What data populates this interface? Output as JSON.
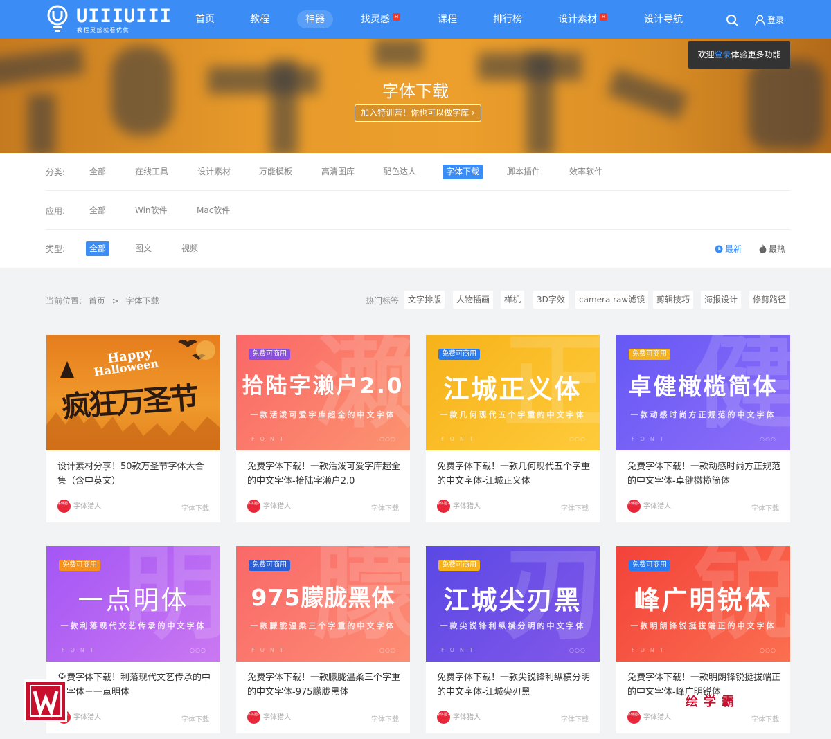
{
  "header": {
    "brand": "UIIIUIII",
    "slogan": "教程灵感就看优优",
    "nav": [
      {
        "label": "首页",
        "hot": false
      },
      {
        "label": "教程",
        "hot": false
      },
      {
        "label": "神器",
        "hot": false
      },
      {
        "label": "找灵感",
        "hot": true
      },
      {
        "label": "课程",
        "hot": false
      },
      {
        "label": "排行榜",
        "hot": false
      },
      {
        "label": "设计素材",
        "hot": true
      },
      {
        "label": "设计导航",
        "hot": false
      }
    ],
    "hot_badge": "H",
    "login": "登录",
    "colors": {
      "primary": "#3b8cf5",
      "hot": "#f0392b"
    }
  },
  "banner": {
    "title": "字体下载",
    "button": "加入特训营！你也可以做字库",
    "tooltip_prefix": "欢迎",
    "tooltip_link": "登录",
    "tooltip_suffix": "体验更多功能"
  },
  "filters": {
    "category": {
      "label": "分类:",
      "options": [
        "全部",
        "在线工具",
        "设计素材",
        "万能模板",
        "高清图库",
        "配色达人",
        "字体下载",
        "脚本插件",
        "效率软件"
      ],
      "active": "字体下载"
    },
    "application": {
      "label": "应用:",
      "options": [
        "全部",
        "Win软件",
        "Mac软件"
      ]
    },
    "type": {
      "label": "类型:",
      "options": [
        "全部",
        "图文",
        "视频"
      ],
      "active": "全部"
    },
    "sort_latest": "最新",
    "sort_hot": "最热"
  },
  "breadcrumb": {
    "prefix": "当前位置:",
    "home": "首页",
    "sep": ">",
    "current": "字体下载"
  },
  "hot_tags": {
    "label": "热门标签",
    "tags": [
      "文字排版",
      "人物插画",
      "样机",
      "3D字效",
      "camera raw滤镜",
      "剪辑技巧",
      "海报设计",
      "修剪路径"
    ]
  },
  "cards": [
    {
      "badge": "",
      "font_name": "",
      "font_desc": "",
      "watermark": "",
      "title": "设计素材分享！50款万圣节字体大合集（含中英文）",
      "author": "字体猎人",
      "category": "字体下载",
      "gradient": [
        "#e07d1f",
        "#f0a233"
      ],
      "badge_color": ""
    },
    {
      "badge": "免费可商用",
      "font_name": "拾陆字濑户2.0",
      "font_desc": "一款活泼可爱字库超全的中文字体",
      "watermark": "濑",
      "title": "免费字体下载！一款活泼可爱字库超全的中文字体-拾陆字濑户2.0",
      "author": "字体猎人",
      "category": "字体下载",
      "gradient": [
        "#fb6d6d",
        "#fb8f6a"
      ],
      "badge_color": "#8a4fe0"
    },
    {
      "badge": "免费可商用",
      "font_name": "江城正义体",
      "font_desc": "一款几何现代五个字重的中文字体",
      "watermark": "正",
      "title": "免费字体下载！一款几何现代五个字重的中文字体-江城正义体",
      "author": "字体猎人",
      "category": "字体下载",
      "gradient": [
        "#f7b61e",
        "#ffc832"
      ],
      "badge_color": "#2b7bf0"
    },
    {
      "badge": "免费可商用",
      "font_name": "卓健橄榄简体",
      "font_desc": "一款动感时尚方正规范的中文字体",
      "watermark": "健",
      "title": "免费字体下载！一款动感时尚方正规范的中文字体-卓健橄榄简体",
      "author": "字体猎人",
      "category": "字体下载",
      "gradient": [
        "#6a5cf6",
        "#8e6df8"
      ],
      "badge_color": "#f5b21d"
    },
    {
      "badge": "免费可商用",
      "font_name": "一点明体",
      "font_desc": "一款利落现代文艺传承的中文字体",
      "watermark": "明",
      "title": "免费字体下载！利落现代文艺传承的中文字体－一点明体",
      "author": "字体猎人",
      "category": "字体下载",
      "gradient": [
        "#a65cf4",
        "#c774f2"
      ],
      "badge_color": "#f5921d"
    },
    {
      "badge": "免费可商用",
      "font_name": "975朦胧黑体",
      "font_desc": "一款朦胧温柔三个字重的中文字体",
      "watermark": "朦",
      "title": "免费字体下载！一款朦胧温柔三个字重的中文字体-975朦胧黑体",
      "author": "字体猎人",
      "category": "字体下载",
      "gradient": [
        "#fa6e6e",
        "#fc8a73"
      ],
      "badge_color": "#2b5fd6"
    },
    {
      "badge": "免费可商用",
      "font_name": "江城尖刃黑",
      "font_desc": "一款尖锐锋利纵横分明的中文字体",
      "watermark": "刃",
      "title": "免费字体下载！一款尖锐锋利纵横分明的中文字体-江城尖刃黑",
      "author": "字体猎人",
      "category": "字体下载",
      "gradient": [
        "#5d4fe6",
        "#7f56e8"
      ],
      "badge_color": "#f5b21d"
    },
    {
      "badge": "免费可商用",
      "font_name": "峰广明锐体",
      "font_desc": "一款明朗锋锐挺拔端正的中文字体",
      "watermark": "锐",
      "title": "免费字体下载！一款明朗锋锐挺拔端正的中文字体-峰广明锐体",
      "author": "字体猎人",
      "category": "字体下载",
      "gradient": [
        "#f5473c",
        "#fb6a4d"
      ],
      "badge_color": "#2b7bf0"
    }
  ],
  "halloween": {
    "line1": "Happy",
    "line2": "Halloween",
    "main": "疯狂万圣节"
  },
  "avatar_text": "字体猎人",
  "font_mark": "FONT",
  "dots": "○○○",
  "overlay": {
    "corner_logo": "W",
    "watermark_right": "绘学霸"
  }
}
